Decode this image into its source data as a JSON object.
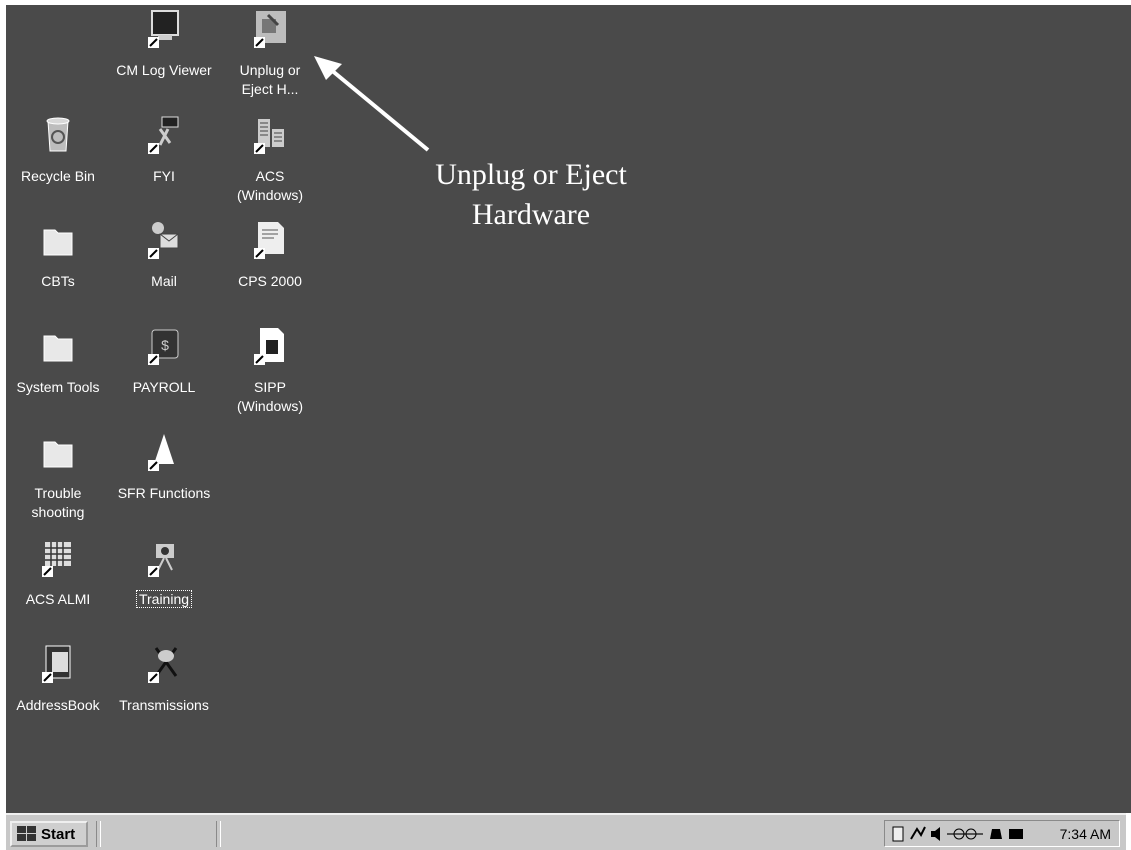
{
  "desktop": {
    "icons": [
      {
        "label": "CM Log Viewer",
        "icon": "monitor-icon"
      },
      {
        "label": "Unplug or\nEject H...",
        "icon": "eject-hardware-icon"
      },
      {
        "label": "Recycle Bin",
        "icon": "recycle-bin-icon"
      },
      {
        "label": "FYI",
        "icon": "fyi-icon"
      },
      {
        "label": "ACS\n(Windows)",
        "icon": "building-icon"
      },
      {
        "label": "CBTs",
        "icon": "folder-icon"
      },
      {
        "label": "Mail",
        "icon": "mail-icon"
      },
      {
        "label": "CPS 2000",
        "icon": "document-icon"
      },
      {
        "label": "System Tools",
        "icon": "folder-icon"
      },
      {
        "label": "PAYROLL",
        "icon": "payroll-icon"
      },
      {
        "label": "SIPP\n(Windows)",
        "icon": "page-icon"
      },
      {
        "label": "Trouble\nshooting",
        "icon": "folder-icon"
      },
      {
        "label": "SFR Functions",
        "icon": "wizard-icon"
      },
      {
        "label": "ACS ALMI",
        "icon": "grid-icon"
      },
      {
        "label": "Training",
        "icon": "camera-icon"
      },
      {
        "label": "AddressBook",
        "icon": "addressbook-icon"
      },
      {
        "label": "Transmissions",
        "icon": "satellite-icon"
      }
    ],
    "annotation": "Unplug or Eject\nHardware"
  },
  "taskbar": {
    "start_label": "Start",
    "clock": "7:34 AM",
    "tray_icons": [
      "pc-card-icon",
      "network-icon",
      "volume-icon",
      "unplug-tray-icon",
      "scanner-icon",
      "display-icon"
    ]
  }
}
